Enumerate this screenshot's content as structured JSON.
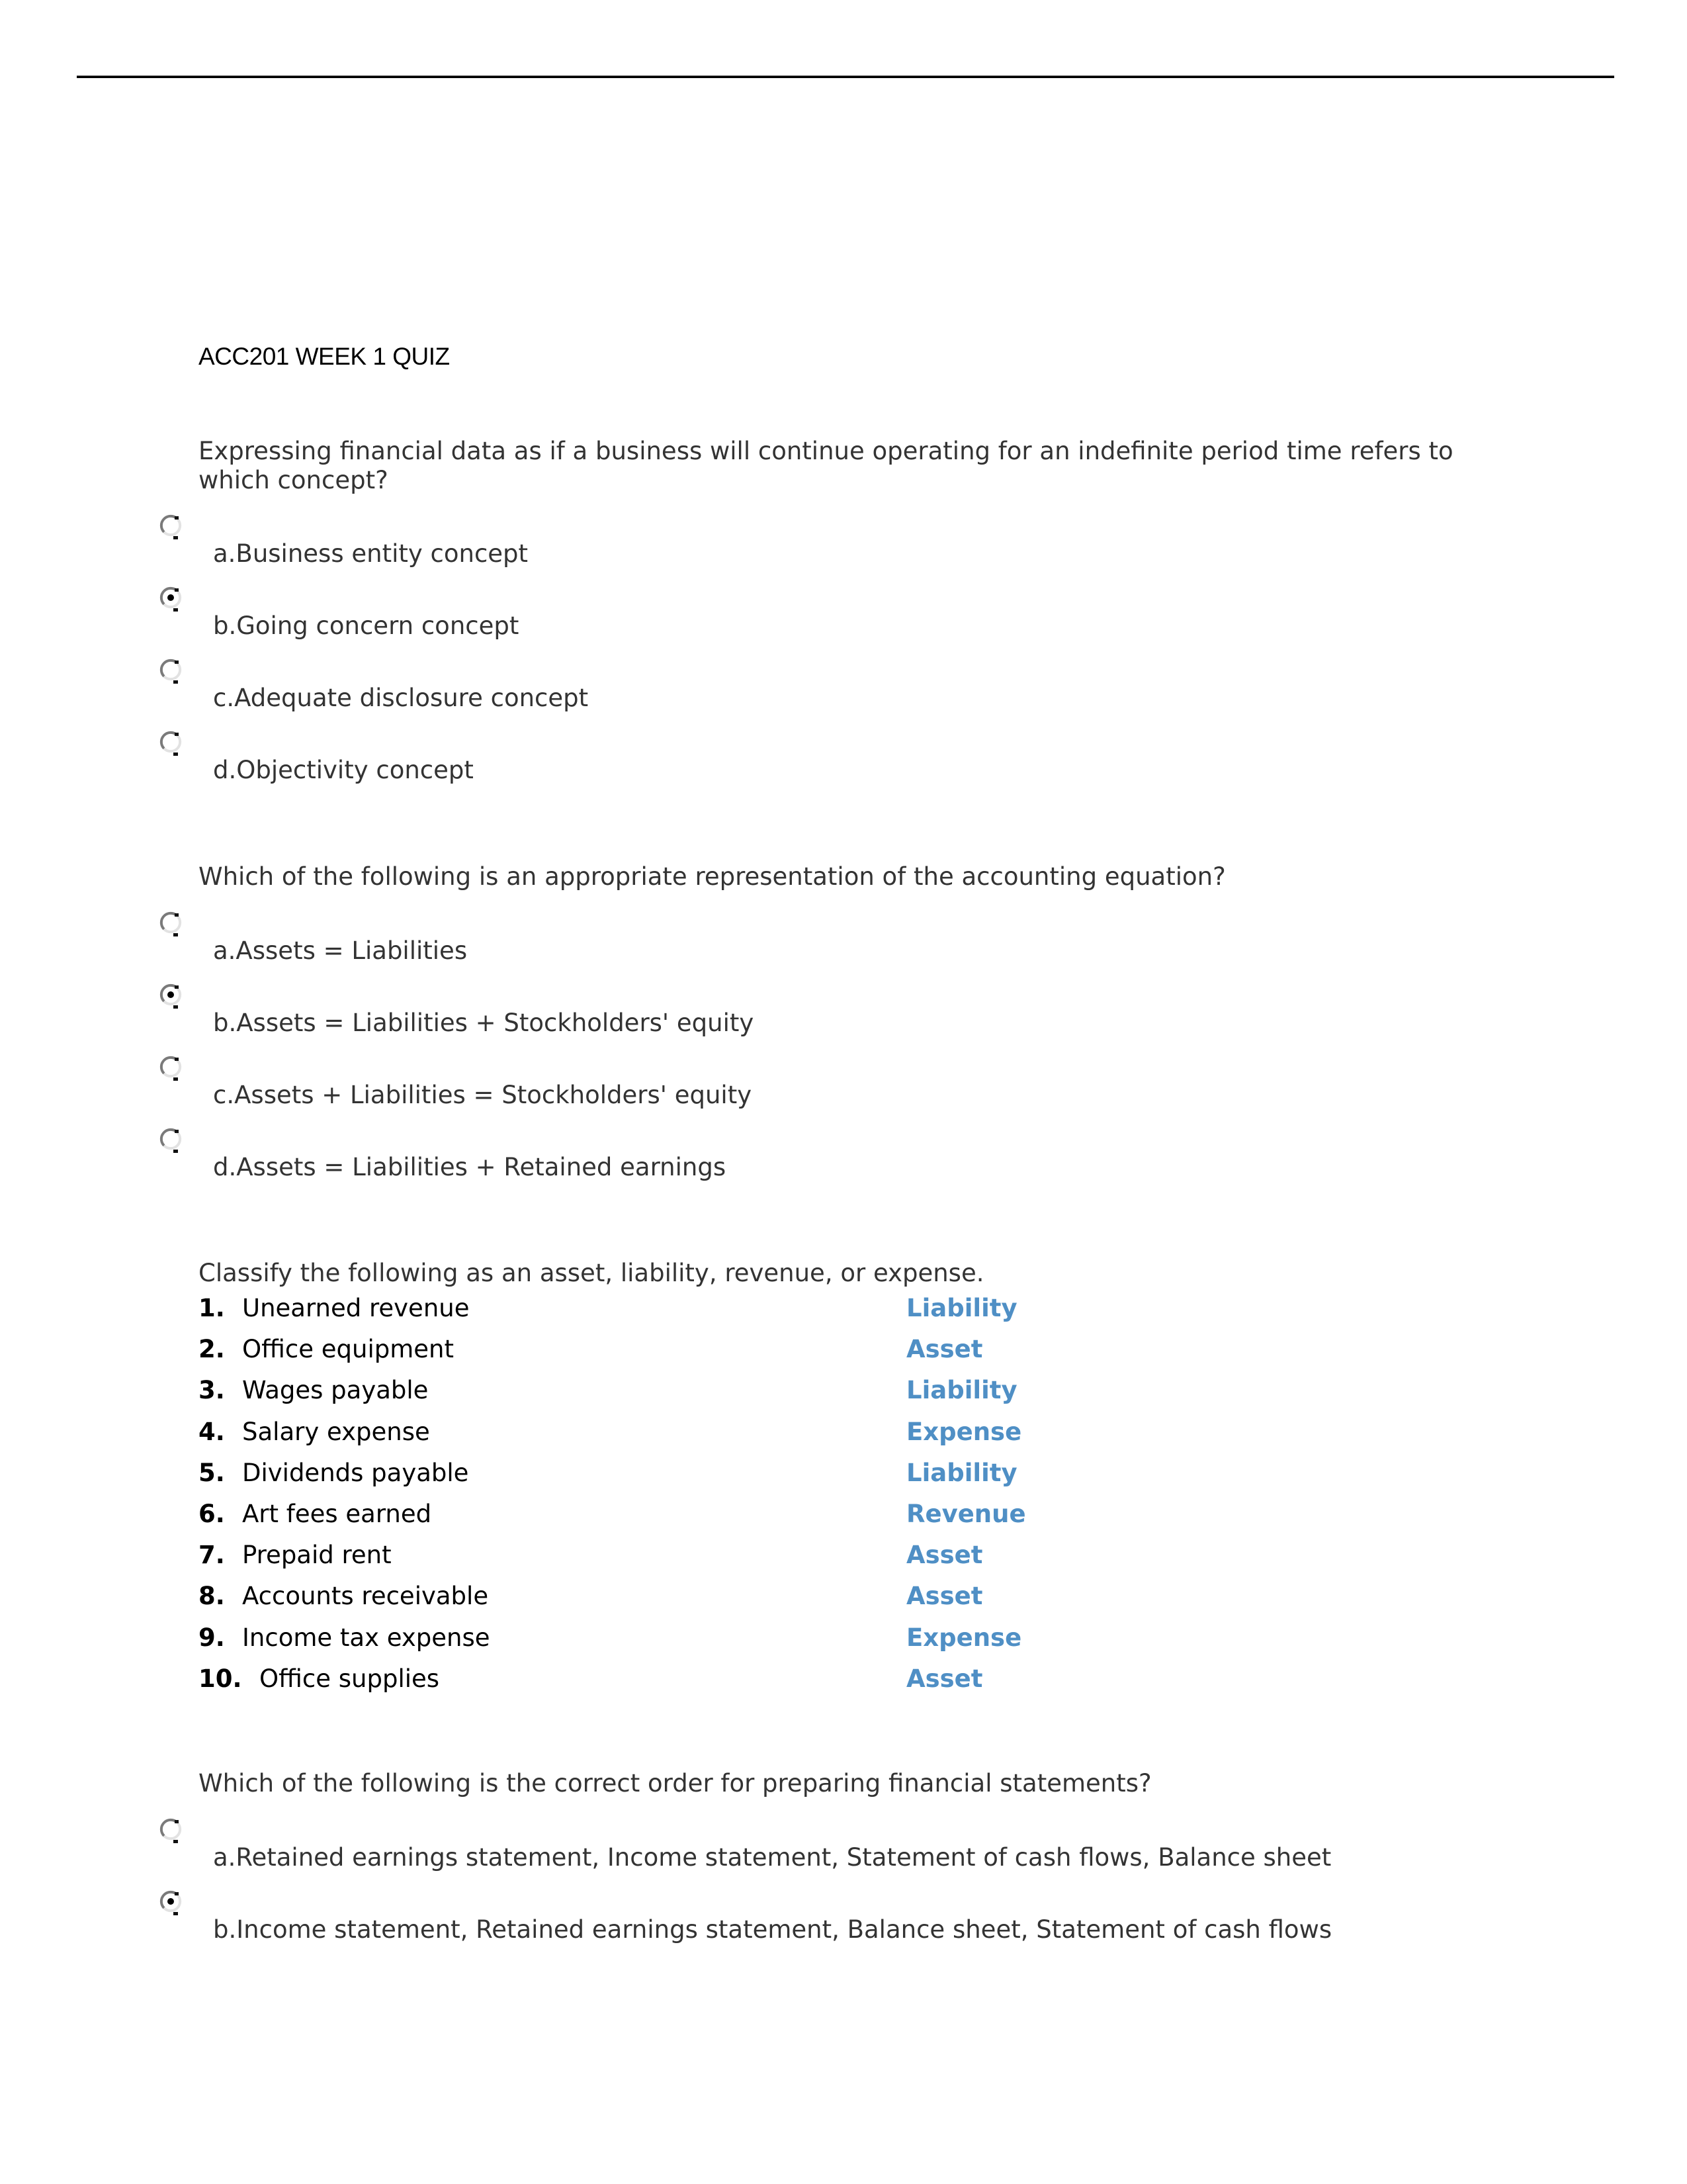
{
  "document": {
    "title": "ACC201 WEEK 1 QUIZ"
  },
  "colors": {
    "answer_blue": "#4f8fc5",
    "text_gray": "#333333"
  },
  "questions": [
    {
      "text": "Expressing financial data as if a business will continue operating for an indefinite period time refers to which concept?",
      "selected": 1,
      "options": [
        {
          "label": "a.Business entity concept"
        },
        {
          "label": "b.Going concern concept"
        },
        {
          "label": "c.Adequate disclosure concept"
        },
        {
          "label": "d.Objectivity concept"
        }
      ]
    },
    {
      "text": "Which of the following is an appropriate representation of the accounting equation?",
      "selected": 1,
      "options": [
        {
          "label": "a.Assets = Liabilities"
        },
        {
          "label": "b.Assets = Liabilities + Stockholders' equity"
        },
        {
          "label": "c.Assets + Liabilities = Stockholders' equity"
        },
        {
          "label": "d.Assets = Liabilities + Retained earnings"
        }
      ]
    }
  ],
  "classification": {
    "prompt": "Classify the following as an asset, liability, revenue, or expense.",
    "items": [
      {
        "num": "1.",
        "term": "Unearned revenue",
        "answer": "Liability"
      },
      {
        "num": "2.",
        "term": "Office equipment",
        "answer": "Asset"
      },
      {
        "num": "3.",
        "term": "Wages payable",
        "answer": "Liability"
      },
      {
        "num": "4.",
        "term": "Salary expense",
        "answer": "Expense"
      },
      {
        "num": "5.",
        "term": "Dividends payable",
        "answer": "Liability"
      },
      {
        "num": "6.",
        "term": "Art fees earned",
        "answer": "Revenue"
      },
      {
        "num": "7.",
        "term": "Prepaid rent",
        "answer": "Asset"
      },
      {
        "num": "8.",
        "term": "Accounts receivable",
        "answer": "Asset"
      },
      {
        "num": "9.",
        "term": "Income tax expense",
        "answer": "Expense"
      },
      {
        "num": "10.",
        "term": "Office supplies",
        "answer": "Asset"
      }
    ]
  },
  "question4": {
    "text": "Which of the following is the correct order for preparing financial statements?",
    "selected": 1,
    "options": [
      {
        "label": "a.Retained earnings statement, Income statement, Statement of cash flows, Balance sheet"
      },
      {
        "label": "b.Income statement, Retained earnings statement, Balance sheet, Statement of cash flows"
      }
    ]
  }
}
